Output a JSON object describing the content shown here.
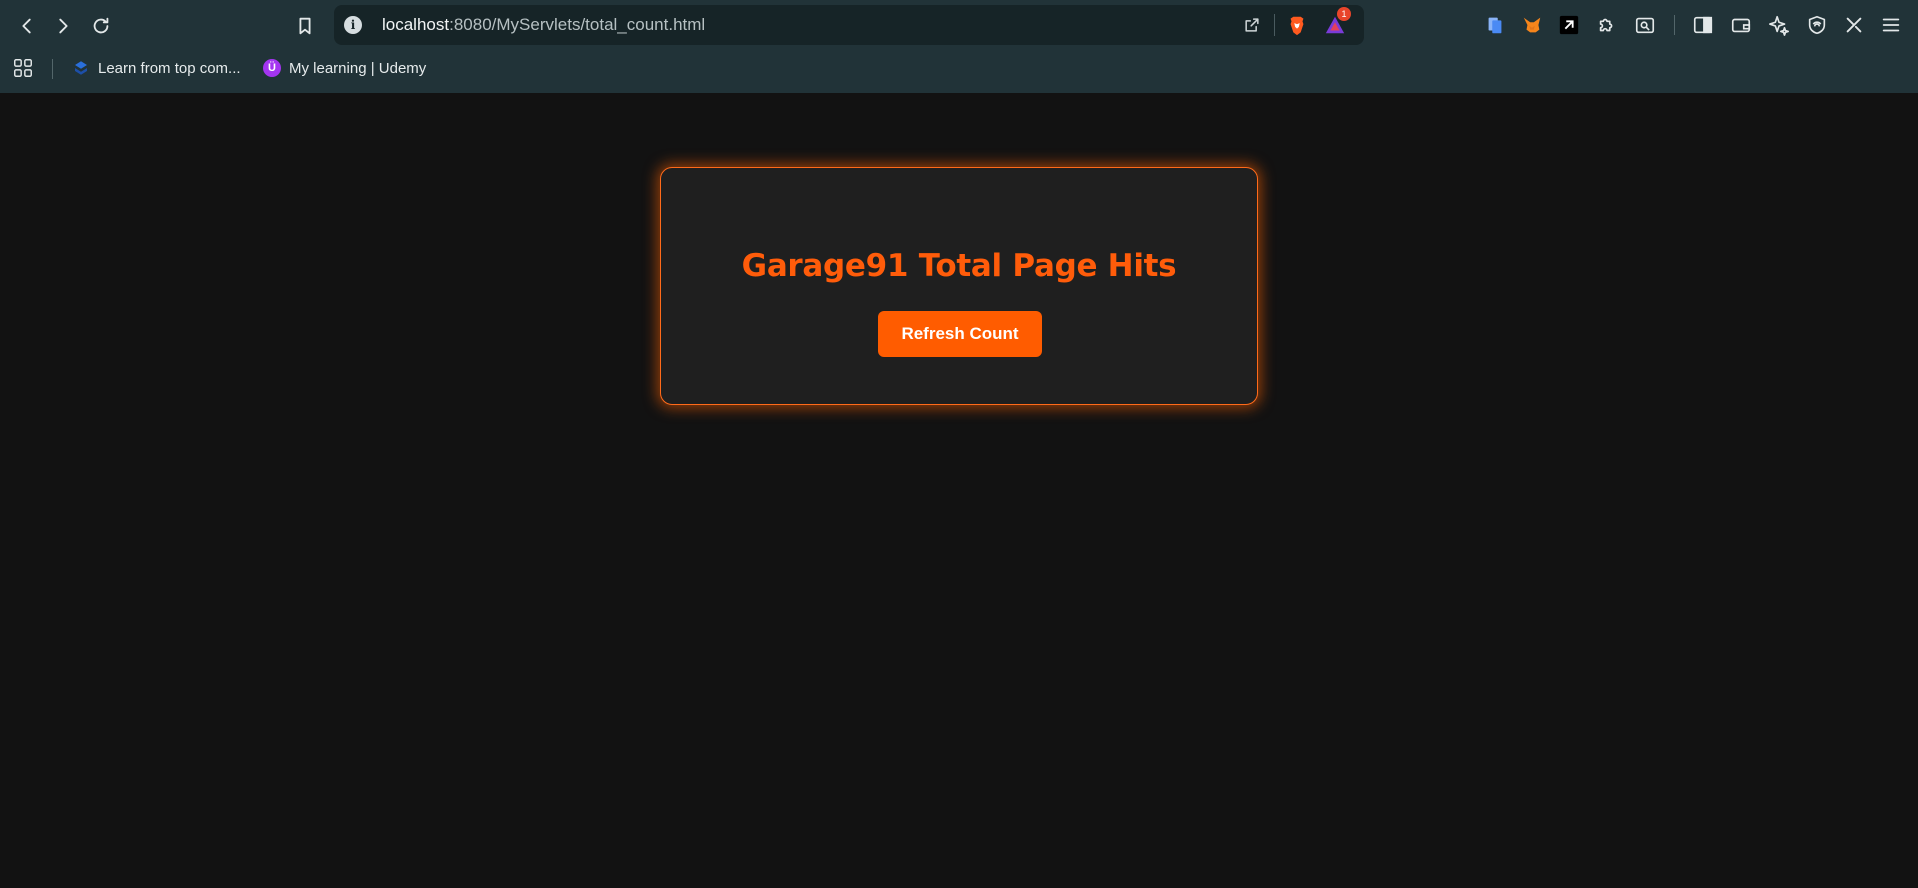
{
  "browser": {
    "address_bar": {
      "url_host": "localhost",
      "url_rest": ":8080/MyServlets/total_count.html",
      "info_icon_glyph": "i",
      "notification_badge": "1"
    },
    "icons": {
      "back": "back-arrow-icon",
      "forward": "forward-arrow-icon",
      "reload": "reload-icon",
      "bookmark": "bookmark-icon",
      "share": "share-icon",
      "brave_shields": "brave-lion-icon",
      "brave_rewards": "brave-rewards-triangle-icon"
    },
    "extensions": [
      {
        "name": "notes-extension-icon"
      },
      {
        "name": "metamask-fox-icon"
      },
      {
        "name": "writing-extension-icon"
      },
      {
        "name": "puzzle-extensions-icon"
      },
      {
        "name": "screen-search-icon"
      },
      {
        "name": "sidebar-toggle-icon"
      },
      {
        "name": "wallet-icon"
      },
      {
        "name": "leo-ai-sparkle-icon"
      },
      {
        "name": "vpn-shield-icon"
      },
      {
        "name": "tools-icon"
      },
      {
        "name": "hamburger-menu-icon"
      }
    ],
    "bookmarks": [
      {
        "label": "Learn from top com...",
        "favicon_color": "#2a6fdb"
      },
      {
        "label": "My learning | Udemy",
        "favicon_color": "#a435f0",
        "favicon_glyph": "Ü"
      }
    ]
  },
  "page": {
    "title": "Garage91 Total Page Hits",
    "refresh_button_label": "Refresh Count",
    "accent_color": "#ff5c00",
    "background_color": "#121212",
    "card_color": "#1f1f1f"
  }
}
